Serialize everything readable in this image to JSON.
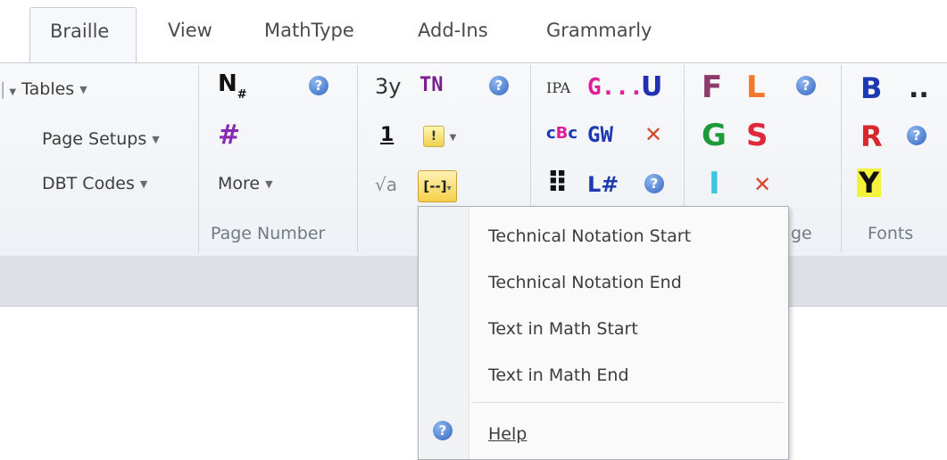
{
  "tabs": [
    {
      "label": "Braille",
      "active": true
    },
    {
      "label": "View"
    },
    {
      "label": "MathType"
    },
    {
      "label": "Add-Ins"
    },
    {
      "label": "Grammarly"
    }
  ],
  "group1": {
    "tables": "Tables",
    "page_setups": "Page Setups",
    "dbt_codes": "DBT Codes"
  },
  "page_number_group": {
    "more": "More",
    "label": "Page Number",
    "icon_n": "N",
    "icon_hash": "#"
  },
  "math_group": {
    "icon_3y": "3y",
    "icon_tn": "TN",
    "icon_1": "1",
    "icon_sqrt": "√a",
    "icon_bracket": "[--]"
  },
  "language_group": {
    "icon_ipa": "IPA",
    "icon_g": "G...",
    "icon_u": "U",
    "icon_cbc": "c",
    "icon_gw": "GW",
    "icon_dots": "⠿",
    "icon_lhash": "L#",
    "label_partial": "ge"
  },
  "format_group": {
    "F": "F",
    "L": "L",
    "G": "G",
    "S": "S",
    "I": "I"
  },
  "fonts_group": {
    "B": "B",
    "R": "R",
    "Y": "Y",
    "more": "..",
    "label": "Fonts"
  },
  "dropdown_menu": {
    "items": [
      {
        "label": "Technical Notation Start"
      },
      {
        "label": "Technical Notation End"
      },
      {
        "label": "Text in Math Start"
      },
      {
        "label": "Text in Math End"
      }
    ],
    "help": "Help"
  },
  "colors": {
    "F": "#8e3a6a",
    "L": "#f07a2a",
    "G": "#1e9a3a",
    "S": "#e0283a",
    "I": "#36c8e0",
    "B": "#1e3ab0",
    "R": "#d8282e",
    "Y": "#111111",
    "Y_bg": "#f4f23a",
    "G_magenta": "#e0209a",
    "U_blue": "#2030b0"
  }
}
